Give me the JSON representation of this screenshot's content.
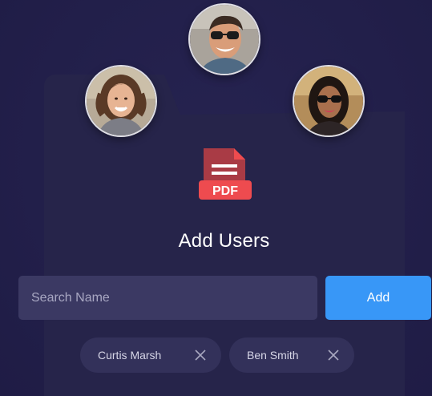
{
  "title": "Add Users",
  "search": {
    "placeholder": "Search Name",
    "value": ""
  },
  "add_button": {
    "label": "Add"
  },
  "file_icon": {
    "label": "PDF",
    "color_red": "#ee4b4f",
    "color_dark_red": "#a93b45"
  },
  "selected_users": [
    {
      "name": "Curtis Marsh"
    },
    {
      "name": "Ben Smith"
    }
  ],
  "colors": {
    "background": "#221f4a",
    "card": "#26244a",
    "input": "#3b3963",
    "accent": "#3897f7",
    "chip": "#33315a"
  }
}
